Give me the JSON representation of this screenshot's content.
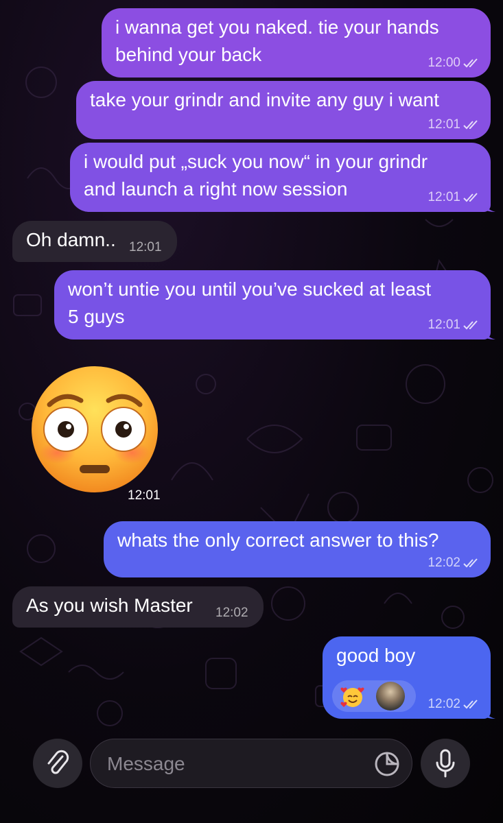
{
  "messages": [
    {
      "id": "m1",
      "dir": "out",
      "text": "i wanna get you naked. tie your hands\nbehind your back",
      "time": "12:00"
    },
    {
      "id": "m2",
      "dir": "out",
      "text": "take your grindr and invite any guy i want",
      "time": "12:01"
    },
    {
      "id": "m3",
      "dir": "out",
      "text": "i would put „suck you now“ in your grindr\nand launch a right now session",
      "time": "12:01"
    },
    {
      "id": "m4",
      "dir": "in",
      "text": "Oh damn..",
      "time": "12:01"
    },
    {
      "id": "m5",
      "dir": "out",
      "text": "won’t untie you until you’ve sucked at least\n5 guys",
      "time": "12:01"
    },
    {
      "id": "m6",
      "dir": "in",
      "sticker": "flushed-face-emoji",
      "time": "12:01"
    },
    {
      "id": "m7",
      "dir": "out",
      "text": "whats the only correct answer to this?",
      "time": "12:02"
    },
    {
      "id": "m8",
      "dir": "in",
      "text": "As you wish Master",
      "time": "12:02"
    },
    {
      "id": "m9",
      "dir": "out",
      "text": "good boy",
      "time": "12:02",
      "reaction": "smiling-face-with-hearts-emoji"
    }
  ],
  "composer": {
    "placeholder": "Message",
    "attach_icon": "paperclip-icon",
    "sticker_icon": "sticker-icon",
    "mic_icon": "microphone-icon"
  },
  "colors": {
    "bubble_out_top": "#8f4fe0",
    "bubble_out_bottom": "#4a67f0",
    "bubble_in": "#2a2430",
    "background": "#0b070f"
  }
}
